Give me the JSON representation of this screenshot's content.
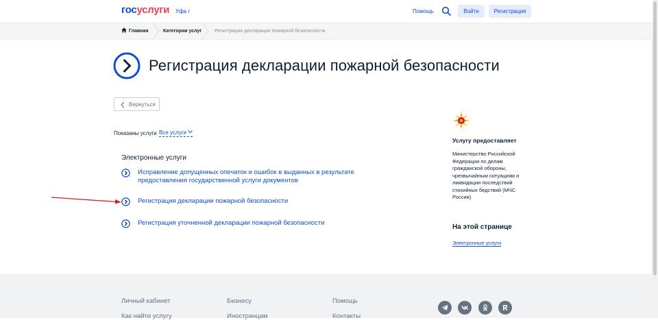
{
  "header": {
    "logo_part1": "гос",
    "logo_part2": "услуги",
    "city": "Уфа г",
    "help": "Помощь",
    "login": "Войти",
    "register": "Регистрация"
  },
  "breadcrumbs": {
    "home": "Главная",
    "categories": "Категории услуг",
    "current": "Регистрация декларации пожарной безопасности"
  },
  "page": {
    "title": "Регистрация декларации пожарной безопасности",
    "back": "Вернуться",
    "shown_label": "Показаны услуги",
    "filter_value": "Все услуги",
    "section_heading": "Электронные услуги",
    "services": [
      "Исправление допущенных опечаток и ошибок в выданных в результате предоставления государственной услуги документов",
      "Регистрация декларации пожарной безопасности",
      "Регистрация уточненной декларации пожарной безопасности"
    ]
  },
  "sidebar": {
    "provider_heading": "Услугу предоставляет",
    "provider_text": "Министерство Российской Федерации по делам гражданской обороны, чрезвычайным ситуациям и ликвидации последствий стихийных бедствий (МЧС России)",
    "onpage_heading": "На этой странице",
    "onpage_link": "Электронные услуги"
  },
  "footer": {
    "links": [
      "Личный кабинет",
      "Бизнесу",
      "Помощь",
      "Как найти услугу",
      "Иностранцам",
      "Контакты"
    ],
    "social": [
      "telegram-icon",
      "vk-icon",
      "odnoklassniki-icon",
      "rutube-icon"
    ]
  },
  "colors": {
    "brand_blue": "#0d4cd3",
    "brand_red": "#ee3f58",
    "annotation_arrow": "#d21f1f"
  }
}
